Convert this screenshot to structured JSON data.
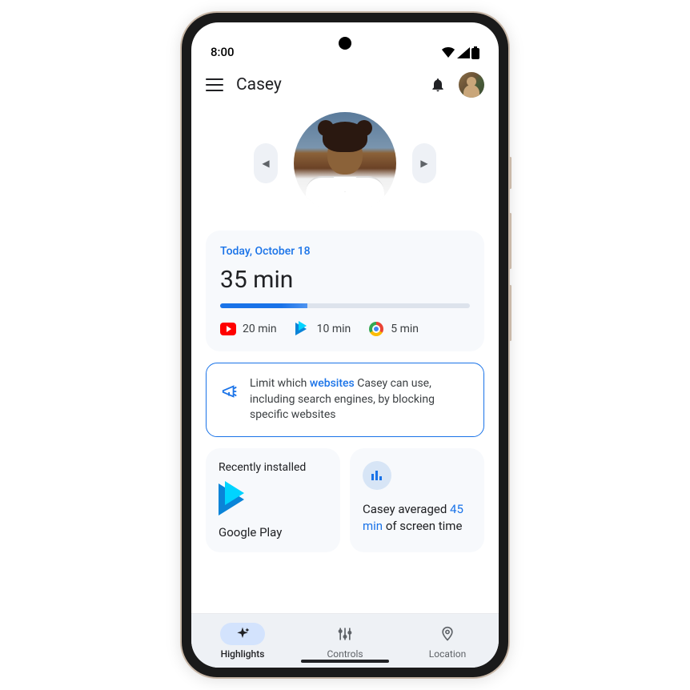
{
  "status_bar": {
    "time": "8:00"
  },
  "app_bar": {
    "title": "Casey"
  },
  "usage_card": {
    "date_label": "Today, October 18",
    "total_time": "35 min",
    "progress_percent": 35,
    "apps": [
      {
        "name": "youtube",
        "time": "20 min"
      },
      {
        "name": "play",
        "time": "10 min"
      },
      {
        "name": "chrome",
        "time": "5 min"
      }
    ]
  },
  "tip": {
    "pre": "Limit which ",
    "link": "websites",
    "post": " Casey can use, including search engines, by blocking specific websites"
  },
  "recent_card": {
    "title": "Recently installed",
    "app_name": "Google Play"
  },
  "average_card": {
    "pre": "Casey averaged ",
    "highlight": "45 min",
    "post": " of screen time"
  },
  "nav": {
    "items": [
      {
        "label": "Highlights",
        "icon": "sparkle"
      },
      {
        "label": "Controls",
        "icon": "sliders"
      },
      {
        "label": "Location",
        "icon": "pin"
      }
    ]
  }
}
